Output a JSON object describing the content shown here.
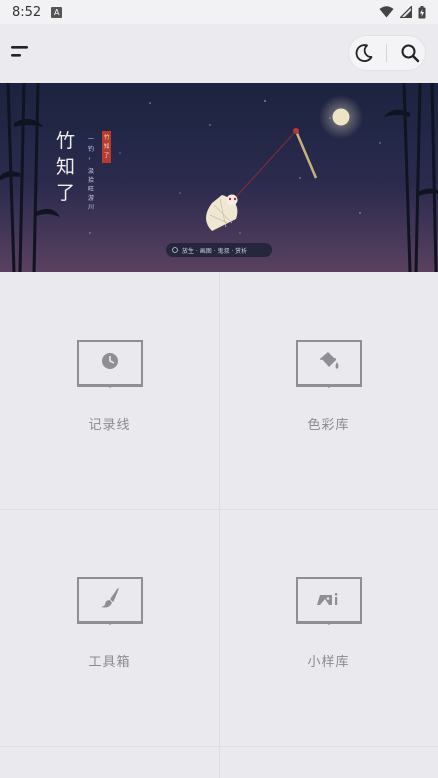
{
  "status": {
    "time": "8:52",
    "a_badge": "A"
  },
  "banner": {
    "title": "竹知了",
    "seal": "竹知了",
    "verse1": "一钓，",
    "verse2": "汲拾旺游川",
    "caption": "放生 · 画图 · 鬼叔 · 赏析"
  },
  "grid": {
    "items": [
      {
        "label": "记录线",
        "icon": "clock-icon"
      },
      {
        "label": "色彩库",
        "icon": "paint-bucket-icon"
      },
      {
        "label": "工具箱",
        "icon": "brush-icon"
      },
      {
        "label": "小样库",
        "icon": "image-ai-icon"
      }
    ]
  }
}
